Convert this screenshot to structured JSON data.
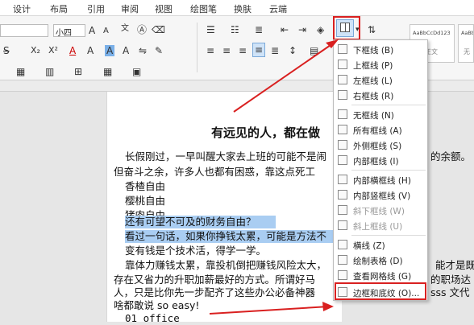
{
  "tabs": [
    "设计",
    "布局",
    "引用",
    "审阅",
    "视图",
    "绘图笔",
    "换肤",
    "云端"
  ],
  "ribbon": {
    "font_size": "小四",
    "grow_font": "A",
    "shrink_font": "A",
    "superscript": "X²",
    "subscript": "X₂",
    "style_preview_1": "AaBbCcDd123",
    "style_preview_1_label": "正文",
    "style_preview_2": "AaBb",
    "style_preview_2_label": "无"
  },
  "document": {
    "title": "有远见的人，都在做",
    "lines": [
      "长假刚过，一早叫醒大家去上班的可能不是闹",
      "但奋斗之余，许多人也都有困惑，靠这点死工",
      "香楂自由",
      "樱桃自由",
      "猪肉自由",
      "还有可望不可及的财务自由？",
      "看过一句话，如果你挣钱太累，可能是方法不",
      "变有钱是个技术活，得学一学。",
      "靠体力赚钱太累，靠投机倒把赚钱风险太大，",
      "存在又省力的升职加薪最好的方式。所谓好马",
      "人，只是比你先一步配齐了这些办公必备神器",
      "啥都敢说 so easy!",
      "01 office"
    ],
    "right_fragments": {
      "line1": "的余额。",
      "line9": "能才是既",
      "line10": "的职场达",
      "line11": "sss 文代"
    }
  },
  "border_menu": {
    "items": [
      {
        "label": "下框线 (B)",
        "disabled": false
      },
      {
        "label": "上框线 (P)",
        "disabled": false
      },
      {
        "label": "左框线 (L)",
        "disabled": false
      },
      {
        "label": "右框线 (R)",
        "disabled": false
      },
      {
        "label": "无框线 (N)",
        "disabled": false
      },
      {
        "label": "所有框线 (A)",
        "disabled": false
      },
      {
        "label": "外侧框线 (S)",
        "disabled": false
      },
      {
        "label": "内部框线 (I)",
        "disabled": false
      },
      {
        "label": "内部横框线 (H)",
        "disabled": false
      },
      {
        "label": "内部竖框线 (V)",
        "disabled": false
      },
      {
        "label": "斜下框线 (W)",
        "disabled": true
      },
      {
        "label": "斜上框线 (U)",
        "disabled": true
      },
      {
        "label": "横线 (Z)",
        "disabled": false
      },
      {
        "label": "绘制表格 (D)",
        "disabled": false
      },
      {
        "label": "查看网格线 (G)",
        "disabled": false
      },
      {
        "label": "边框和底纹 (O)...",
        "disabled": false
      }
    ]
  },
  "colors": {
    "highlight": "#a9cdf2",
    "annotation_red": "#d92020",
    "selected_button": "#cfe3f8"
  }
}
